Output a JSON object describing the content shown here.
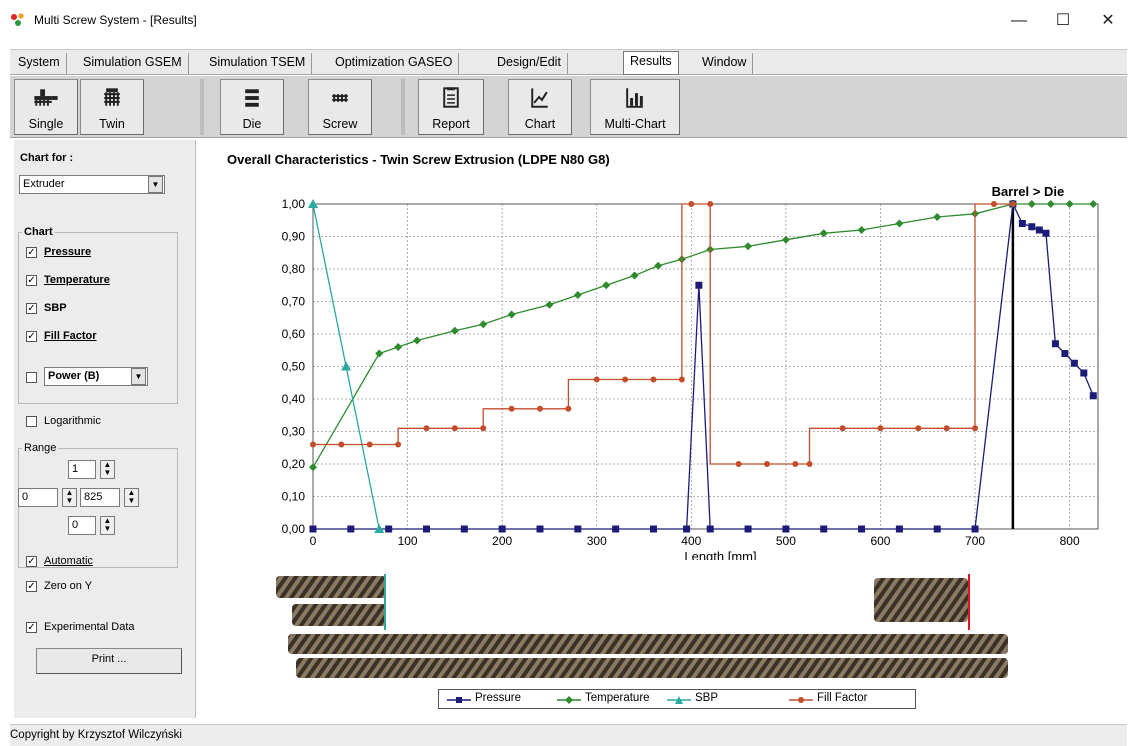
{
  "window": {
    "title": "Multi Screw System - [Results]",
    "controls": {
      "minimize": "—",
      "maximize": "☐",
      "close": "✕"
    }
  },
  "menu": {
    "tabs": [
      "System",
      "Simulation GSEM",
      "Simulation TSEM",
      "Optimization GASEO",
      "Design/Edit",
      "Results",
      "Window"
    ],
    "active": "Results"
  },
  "toolbar": {
    "buttons": [
      {
        "label": "Single",
        "icon": "single-screw-icon"
      },
      {
        "label": "Twin",
        "icon": "twin-screw-icon"
      },
      {
        "label": "Die",
        "icon": "die-icon"
      },
      {
        "label": "Screw",
        "icon": "screw-icon"
      },
      {
        "label": "Report",
        "icon": "report-icon"
      },
      {
        "label": "Chart",
        "icon": "chart-icon"
      },
      {
        "label": "Multi-Chart",
        "icon": "multi-chart-icon"
      }
    ]
  },
  "left_panel": {
    "chart_for_label": "Chart for :",
    "chart_for_value": "Extruder",
    "chart_group_label": "Chart",
    "series_checks": [
      {
        "label": "Pressure",
        "checked": true
      },
      {
        "label": "Temperature",
        "checked": true
      },
      {
        "label": "SBP",
        "checked": true
      },
      {
        "label": "Fill Factor",
        "checked": true
      }
    ],
    "power_checked": false,
    "power_value": "Power (B)",
    "logarithmic_label": "Logarithmic",
    "logarithmic_checked": false,
    "range_label": "Range",
    "range_value_1": "1",
    "range_from": "0",
    "range_to": "825",
    "range_value_3": "0",
    "automatic_label": "Automatic",
    "automatic_checked": true,
    "zero_on_y_label": "Zero on Y",
    "zero_on_y_checked": true,
    "experimental_label": "Experimental Data",
    "experimental_checked": true,
    "print_label": "Print ..."
  },
  "chart_data": {
    "type": "line",
    "title": "Overall Characteristics - Twin Screw Extrusion (LDPE N80 G8)",
    "xlabel": "Length [mm]",
    "ylabel": "",
    "xlim": [
      0,
      830
    ],
    "ylim": [
      0,
      1
    ],
    "x_ticks": [
      0,
      100,
      200,
      300,
      400,
      500,
      600,
      700,
      800
    ],
    "y_ticks": [
      "0,00",
      "0,10",
      "0,20",
      "0,30",
      "0,40",
      "0,50",
      "0,60",
      "0,70",
      "0,80",
      "0,90",
      "1,00"
    ],
    "grid": true,
    "legend_position": "bottom",
    "annotation": "Barrel > Die",
    "marker_x": 740,
    "series": [
      {
        "name": "Pressure",
        "color": "#1c1c78",
        "marker": "square",
        "points": [
          [
            0,
            0
          ],
          [
            40,
            0
          ],
          [
            80,
            0
          ],
          [
            120,
            0
          ],
          [
            160,
            0
          ],
          [
            200,
            0
          ],
          [
            240,
            0
          ],
          [
            280,
            0
          ],
          [
            320,
            0
          ],
          [
            360,
            0
          ],
          [
            395,
            0
          ],
          [
            408,
            0.75
          ],
          [
            420,
            0
          ],
          [
            460,
            0
          ],
          [
            500,
            0
          ],
          [
            540,
            0
          ],
          [
            580,
            0
          ],
          [
            620,
            0
          ],
          [
            660,
            0
          ],
          [
            700,
            0
          ],
          [
            740,
            1
          ],
          [
            750,
            0.94
          ],
          [
            760,
            0.93
          ],
          [
            768,
            0.92
          ],
          [
            775,
            0.91
          ],
          [
            785,
            0.57
          ],
          [
            795,
            0.54
          ],
          [
            805,
            0.51
          ],
          [
            815,
            0.48
          ],
          [
            825,
            0.41
          ]
        ]
      },
      {
        "name": "Temperature",
        "color": "#2e8b2e",
        "marker": "diamond",
        "points": [
          [
            0,
            0.19
          ],
          [
            70,
            0.54
          ],
          [
            90,
            0.56
          ],
          [
            110,
            0.58
          ],
          [
            150,
            0.61
          ],
          [
            180,
            0.63
          ],
          [
            210,
            0.66
          ],
          [
            250,
            0.69
          ],
          [
            280,
            0.72
          ],
          [
            310,
            0.75
          ],
          [
            340,
            0.78
          ],
          [
            365,
            0.81
          ],
          [
            390,
            0.83
          ],
          [
            420,
            0.86
          ],
          [
            460,
            0.87
          ],
          [
            500,
            0.89
          ],
          [
            540,
            0.91
          ],
          [
            580,
            0.92
          ],
          [
            620,
            0.94
          ],
          [
            660,
            0.96
          ],
          [
            700,
            0.97
          ],
          [
            740,
            1
          ],
          [
            760,
            1
          ],
          [
            780,
            1
          ],
          [
            800,
            1
          ],
          [
            825,
            1
          ]
        ]
      },
      {
        "name": "SBP",
        "color": "#2aa9a0",
        "marker": "triangle",
        "points": [
          [
            0,
            1
          ],
          [
            35,
            0.5
          ],
          [
            70,
            0
          ]
        ]
      },
      {
        "name": "Fill Factor",
        "color": "#c24e2c",
        "marker": "dot",
        "step": true,
        "points": [
          [
            0,
            0.26
          ],
          [
            30,
            0.26
          ],
          [
            60,
            0.26
          ],
          [
            90,
            0.26
          ],
          [
            90,
            0.31
          ],
          [
            120,
            0.31
          ],
          [
            150,
            0.31
          ],
          [
            180,
            0.31
          ],
          [
            180,
            0.37
          ],
          [
            210,
            0.37
          ],
          [
            240,
            0.37
          ],
          [
            270,
            0.37
          ],
          [
            270,
            0.46
          ],
          [
            300,
            0.46
          ],
          [
            330,
            0.46
          ],
          [
            360,
            0.46
          ],
          [
            390,
            0.46
          ],
          [
            390,
            1
          ],
          [
            400,
            1
          ],
          [
            420,
            1
          ],
          [
            420,
            0.2
          ],
          [
            450,
            0.2
          ],
          [
            480,
            0.2
          ],
          [
            510,
            0.2
          ],
          [
            525,
            0.2
          ],
          [
            525,
            0.31
          ],
          [
            560,
            0.31
          ],
          [
            600,
            0.31
          ],
          [
            640,
            0.31
          ],
          [
            670,
            0.31
          ],
          [
            700,
            0.31
          ],
          [
            700,
            1
          ],
          [
            720,
            1
          ],
          [
            740,
            1
          ]
        ]
      }
    ]
  },
  "status": {
    "copyright": "Copyright by Krzysztof Wilczyński"
  },
  "colors": {
    "accent": "#e01a1a",
    "window_bg": "#ececec",
    "toolbar_bg": "#d4d4d4"
  }
}
